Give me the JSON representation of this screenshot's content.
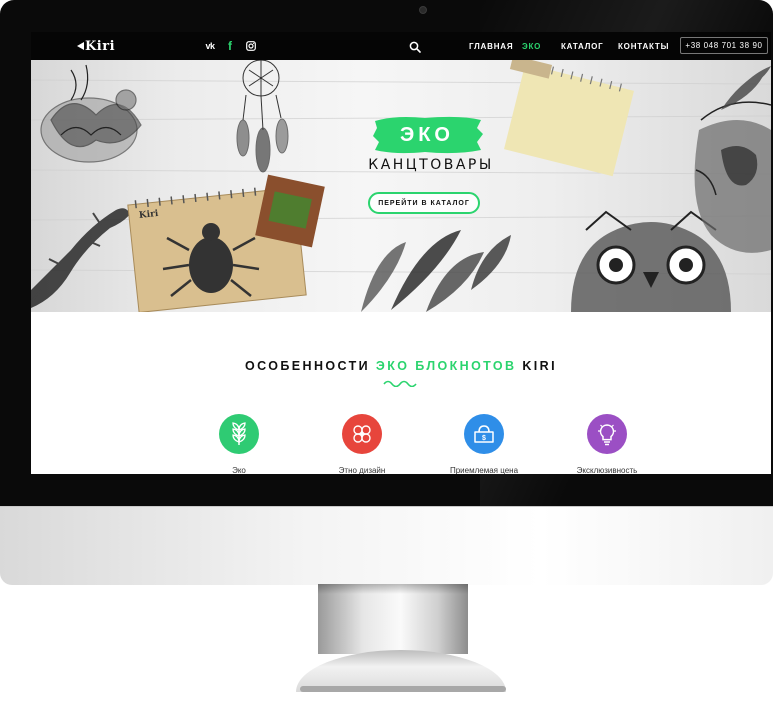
{
  "nav": {
    "logo": "Kiri",
    "social": [
      {
        "name": "vk",
        "glyph": "vk"
      },
      {
        "name": "facebook",
        "glyph": "f"
      },
      {
        "name": "instagram"
      }
    ],
    "menu": [
      "Главная",
      "Эко",
      "Каталог",
      "Контакты"
    ],
    "active_menu": "Эко",
    "phone": "+38 048 701 38 90"
  },
  "hero": {
    "badge": "Эко",
    "subtitle": "канцтовары",
    "button": "Перейти в каталог",
    "notebook_brand": "Kiri"
  },
  "features": {
    "title_pre": "Особенности ",
    "title_accent": "эко блокнотов",
    "title_post": " Kiri",
    "items": [
      {
        "label": "Эко",
        "icon": "wheat-icon",
        "color": "#2fcb73"
      },
      {
        "label": "Этно дизайн",
        "icon": "ethno-pattern-icon",
        "color": "#e7453c"
      },
      {
        "label": "Приемлемая цена",
        "icon": "wallet-icon",
        "color": "#2f8ee8"
      },
      {
        "label": "Эксклюзивность",
        "icon": "lightbulb-icon",
        "color": "#9b4fc4"
      }
    ]
  },
  "colors": {
    "accent": "#2bd46e",
    "nav_bg": "#050505",
    "bezel": "#0a0a0a"
  }
}
